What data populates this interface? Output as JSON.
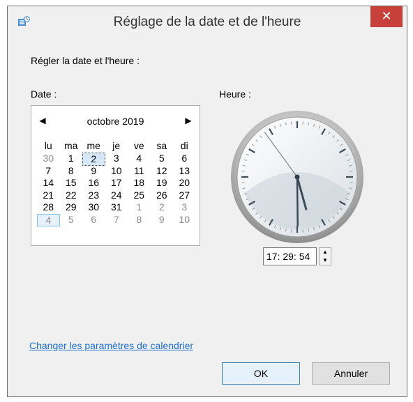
{
  "window": {
    "title": "Réglage de la date et de l'heure",
    "close_glyph": "✕",
    "title_icon": "clock-settings-icon"
  },
  "labels": {
    "set_date_time": "Régler la date et l'heure :",
    "date": "Date :",
    "time": "Heure :"
  },
  "calendar": {
    "month_label": "octobre 2019",
    "prev_glyph": "◀",
    "next_glyph": "▶",
    "days_of_week": [
      "lu",
      "ma",
      "me",
      "je",
      "ve",
      "sa",
      "di"
    ],
    "weeks": [
      [
        {
          "d": "30",
          "muted": true
        },
        {
          "d": "1"
        },
        {
          "d": "2",
          "selected": true
        },
        {
          "d": "3"
        },
        {
          "d": "4"
        },
        {
          "d": "5"
        },
        {
          "d": "6"
        }
      ],
      [
        {
          "d": "7"
        },
        {
          "d": "8"
        },
        {
          "d": "9"
        },
        {
          "d": "10"
        },
        {
          "d": "11"
        },
        {
          "d": "12"
        },
        {
          "d": "13"
        }
      ],
      [
        {
          "d": "14"
        },
        {
          "d": "15"
        },
        {
          "d": "16"
        },
        {
          "d": "17"
        },
        {
          "d": "18"
        },
        {
          "d": "19"
        },
        {
          "d": "20"
        }
      ],
      [
        {
          "d": "21"
        },
        {
          "d": "22"
        },
        {
          "d": "23"
        },
        {
          "d": "24"
        },
        {
          "d": "25"
        },
        {
          "d": "26"
        },
        {
          "d": "27"
        }
      ],
      [
        {
          "d": "28"
        },
        {
          "d": "29"
        },
        {
          "d": "30"
        },
        {
          "d": "31"
        },
        {
          "d": "1",
          "muted": true
        },
        {
          "d": "2",
          "muted": true
        },
        {
          "d": "3",
          "muted": true
        }
      ],
      [
        {
          "d": "4",
          "muted": true,
          "today": true
        },
        {
          "d": "5",
          "muted": true
        },
        {
          "d": "6",
          "muted": true
        },
        {
          "d": "7",
          "muted": true
        },
        {
          "d": "8",
          "muted": true
        },
        {
          "d": "9",
          "muted": true
        },
        {
          "d": "10",
          "muted": true
        }
      ]
    ]
  },
  "time": {
    "value": "17: 29: 54",
    "hour": 17,
    "minute": 29,
    "second": 54,
    "spin_up_glyph": "▲",
    "spin_down_glyph": "▼"
  },
  "link": {
    "change_calendar": "Changer les paramètres de calendrier"
  },
  "buttons": {
    "ok": "OK",
    "cancel": "Annuler"
  },
  "colors": {
    "close_red": "#c7403a",
    "link_blue": "#1d6fd1",
    "selection_blue": "#7ec0ee"
  }
}
